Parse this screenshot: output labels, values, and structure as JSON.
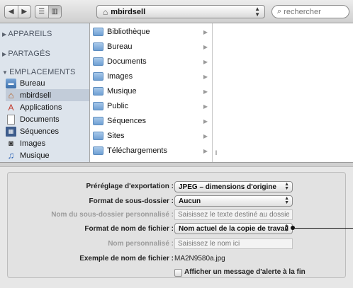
{
  "toolbar": {
    "path_label": "mbirdsell",
    "search_placeholder": "rechercher"
  },
  "sidebar": {
    "sections": [
      {
        "label": "APPAREILS"
      },
      {
        "label": "PARTAGÉS"
      },
      {
        "label": "EMPLACEMENTS"
      }
    ],
    "items": [
      {
        "label": "Bureau",
        "icon": "desktop-icon"
      },
      {
        "label": "mbirdsell",
        "icon": "home-icon"
      },
      {
        "label": "Applications",
        "icon": "applications-icon"
      },
      {
        "label": "Documents",
        "icon": "documents-icon"
      },
      {
        "label": "Séquences",
        "icon": "film-icon"
      },
      {
        "label": "Images",
        "icon": "camera-icon"
      },
      {
        "label": "Musique",
        "icon": "music-note-icon"
      }
    ]
  },
  "browser": {
    "column1": [
      {
        "label": "Bibliothèque"
      },
      {
        "label": "Bureau"
      },
      {
        "label": "Documents"
      },
      {
        "label": "Images"
      },
      {
        "label": "Musique"
      },
      {
        "label": "Public"
      },
      {
        "label": "Séquences"
      },
      {
        "label": "Sites"
      },
      {
        "label": "Téléchargements"
      }
    ]
  },
  "export": {
    "preset_label": "Préréglage d'exportation :",
    "preset_value": "JPEG – dimensions d'origine",
    "subfolder_format_label": "Format de sous-dossier :",
    "subfolder_format_value": "Aucun",
    "custom_subfolder_label": "Nom du sous-dossier personnalisé :",
    "custom_subfolder_placeholder": "Saisissez le texte destiné au dossier",
    "filename_format_label": "Format de nom de fichier :",
    "filename_format_value": "Nom actuel de la copie de travail",
    "custom_name_label": "Nom personnalisé :",
    "custom_name_placeholder": "Saisissez le nom ici",
    "example_label": "Exemple de nom de fichier :",
    "example_value": "MA2N9580a.jpg",
    "alert_checkbox_label": "Afficher un message d'alerte à la fin"
  }
}
